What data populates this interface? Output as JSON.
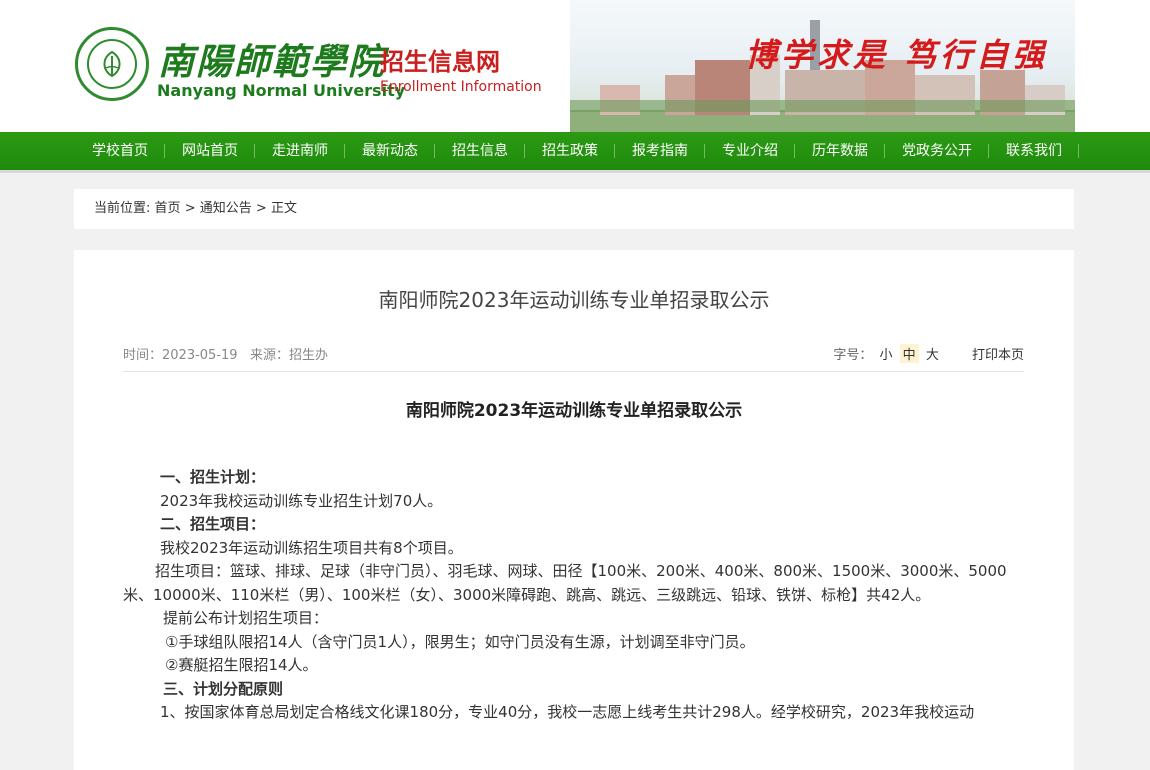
{
  "header": {
    "logo_cn": "南陽師範學院",
    "logo_cn_suffix": "招生信息网",
    "logo_en": "Nanyang Normal University",
    "logo_en_suffix": "Enrollment Information",
    "motto": "博学求是 笃行自强",
    "colors": {
      "brand_green": "#1d7a1d",
      "brand_red": "#c91f1f",
      "nav_green": "#2c9a14"
    }
  },
  "nav": {
    "items": [
      "学校首页",
      "网站首页",
      "走进南师",
      "最新动态",
      "招生信息",
      "招生政策",
      "报考指南",
      "专业介绍",
      "历年数据",
      "党政务公开",
      "联系我们"
    ]
  },
  "breadcrumb": {
    "label": "当前位置:",
    "items": [
      "首页",
      "通知公告",
      "正文"
    ],
    "separator": ">"
  },
  "article": {
    "title": "南阳师院2023年运动训练专业单招录取公示",
    "time": "时间：2023-05-19",
    "source": "来源：招生办",
    "font_size_label": "字号：",
    "font_sizes": [
      "小",
      "中",
      "大"
    ],
    "print_label": "打印本页",
    "body_title": "南阳师院2023年运动训练专业单招录取公示",
    "paragraphs": {
      "h1": "一、招生计划：",
      "p1": "2023年我校运动训练专业招生计划70人。",
      "h2": "二、招生项目：",
      "p2": "我校2023年运动训练招生项目共有8个项目。",
      "p3": "招生项目：篮球、排球、足球（非守门员）、羽毛球、网球、田径【100米、200米、400米、800米、1500米、3000米、5000米、10000米、110米栏（男）、100米栏（女）、3000米障碍跑、跳高、跳远、三级跳远、铅球、铁饼、标枪】共42人。",
      "p4": "提前公布计划招生项目：",
      "p5": "①手球组队限招14人（含守门员1人），限男生；如守门员没有生源，计划调至非守门员。",
      "p6": "②赛艇招生限招14人。",
      "h3": "三、计划分配原则",
      "p7": "1、按国家体育总局划定合格线文化课180分，专业40分，我校一志愿上线考生共计298人。经学校研究，2023年我校运动"
    }
  }
}
